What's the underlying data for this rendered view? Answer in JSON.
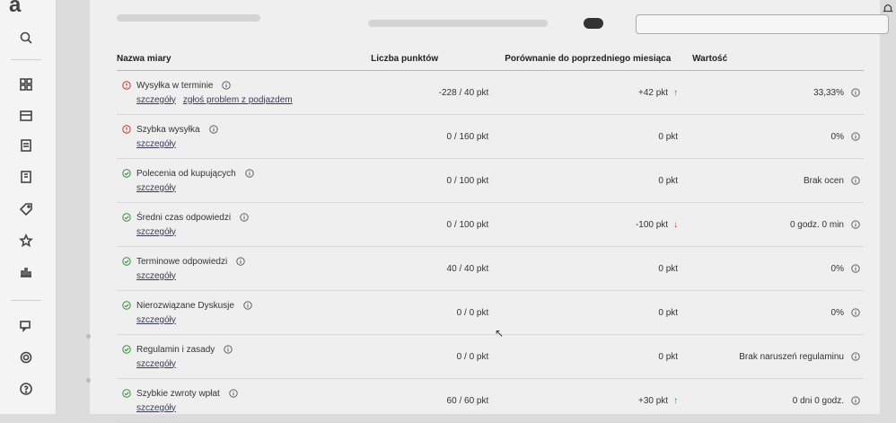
{
  "app": {
    "logo_text": "a"
  },
  "sidebar": {
    "icons": [
      "search-icon",
      "grid-icon",
      "box-icon",
      "document-icon",
      "list-icon",
      "tag-icon",
      "star-icon",
      "chart-icon",
      "chat-icon",
      "gear-icon",
      "help-icon"
    ]
  },
  "table": {
    "headers": {
      "name": "Nazwa miary",
      "points": "Liczba punktów",
      "comparison": "Porównanie do poprzedniego miesiąca",
      "value": "Wartość"
    },
    "rows": [
      {
        "name": "Wysyłka w terminie",
        "status": "warning",
        "links": [
          "szczegóły",
          "zgłoś problem z podjazdem"
        ],
        "points": "-228 / 40 pkt",
        "comparison": "+42 pkt",
        "trend": "up",
        "value": "33,33%"
      },
      {
        "name": "Szybka wysyłka",
        "status": "warning",
        "links": [
          "szczegóły"
        ],
        "points": "0 / 160 pkt",
        "comparison": "0 pkt",
        "trend": "",
        "value": "0%"
      },
      {
        "name": "Polecenia od kupujących",
        "status": "ok",
        "links": [
          "szczegóły"
        ],
        "points": "0 / 100 pkt",
        "comparison": "0 pkt",
        "trend": "",
        "value": "Brak ocen"
      },
      {
        "name": "Średni czas odpowiedzi",
        "status": "ok",
        "links": [
          "szczegóły"
        ],
        "points": "0 / 100 pkt",
        "comparison": "-100 pkt",
        "trend": "down",
        "value": "0 godz. 0 min"
      },
      {
        "name": "Terminowe odpowiedzi",
        "status": "ok",
        "links": [
          "szczegóły"
        ],
        "points": "40 / 40 pkt",
        "comparison": "0 pkt",
        "trend": "",
        "value": "0%"
      },
      {
        "name": "Nierozwiązane Dyskusje",
        "status": "ok",
        "links": [
          "szczegóły"
        ],
        "points": "0 / 0 pkt",
        "comparison": "0 pkt",
        "trend": "",
        "value": "0%"
      },
      {
        "name": "Regulamin i zasady",
        "status": "ok",
        "links": [
          "szczegóły"
        ],
        "points": "0 / 0 pkt",
        "comparison": "0 pkt",
        "trend": "",
        "value": "Brak naruszeń regulaminu"
      },
      {
        "name": "Szybkie zwroty wpłat",
        "status": "ok",
        "links": [
          "szczegóły"
        ],
        "points": "60 / 60 pkt",
        "comparison": "+30 pkt",
        "trend": "up",
        "value": "0 dni 0 godz."
      }
    ]
  },
  "colors": {
    "ok": "#3a8d3a",
    "warning": "#c0392b"
  }
}
